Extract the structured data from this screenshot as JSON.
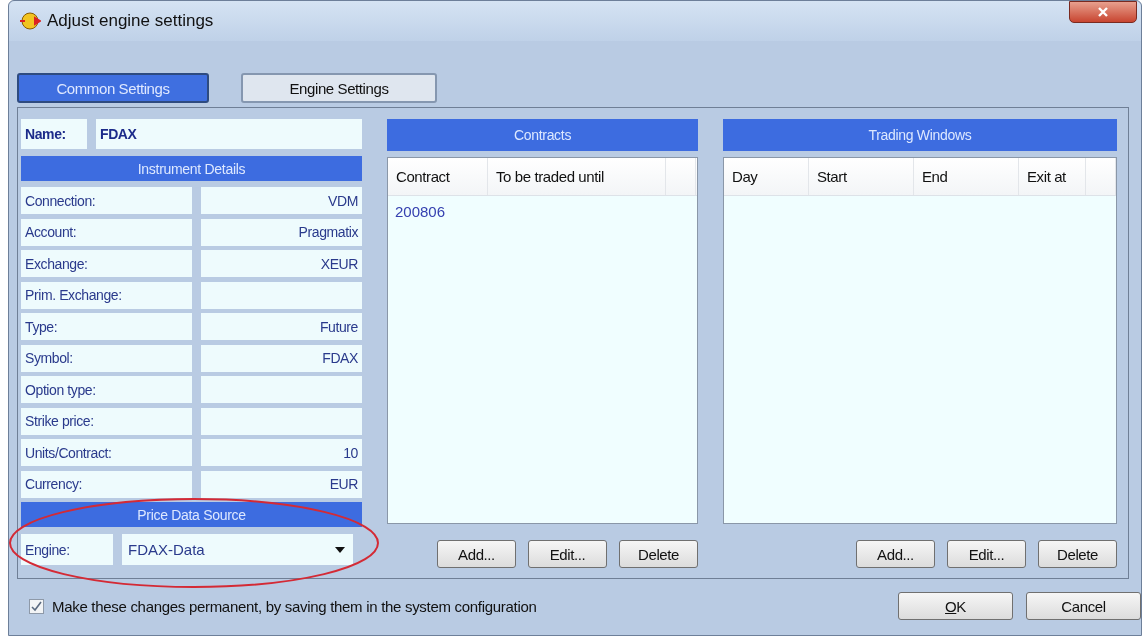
{
  "window": {
    "title": "Adjust engine settings"
  },
  "tabs": [
    {
      "label": "Common Settings",
      "selected": true
    },
    {
      "label": "Engine Settings",
      "selected": false
    }
  ],
  "name": {
    "label": "Name:",
    "value": "FDAX"
  },
  "instrument_details": {
    "title": "Instrument Details",
    "rows": [
      {
        "label": "Connection:",
        "value": "VDM"
      },
      {
        "label": "Account:",
        "value": "Pragmatix"
      },
      {
        "label": "Exchange:",
        "value": "XEUR"
      },
      {
        "label": "Prim. Exchange:"
      },
      {
        "label": "Type:",
        "value": "Future"
      },
      {
        "label": "Symbol:",
        "value": "FDAX"
      },
      {
        "label": "Option type:"
      },
      {
        "label": "Strike price:"
      },
      {
        "label": "Units/Contract:",
        "value": "10"
      },
      {
        "label": "Currency:",
        "value": "EUR"
      }
    ]
  },
  "price_data_source": {
    "title": "Price Data Source",
    "engine": {
      "label": "Engine:",
      "value": "FDAX-Data"
    }
  },
  "contracts": {
    "title": "Contracts",
    "columns": [
      "Contract",
      "To be traded until"
    ],
    "rows": [
      [
        "200806"
      ]
    ],
    "buttons": [
      "Add...",
      "Edit...",
      "Delete"
    ]
  },
  "trading_windows": {
    "title": "Trading Windows",
    "columns": [
      "Day",
      "Start",
      "End",
      "Exit at"
    ],
    "buttons": [
      "Add...",
      "Edit...",
      "Delete"
    ]
  },
  "permanent": {
    "label": "Make these changes permanent, by saving them in the system configuration",
    "checked": true
  },
  "buttons": [
    {
      "label": "OK",
      "kind": "default"
    },
    {
      "label": "Cancel",
      "kind": "normal"
    }
  ]
}
